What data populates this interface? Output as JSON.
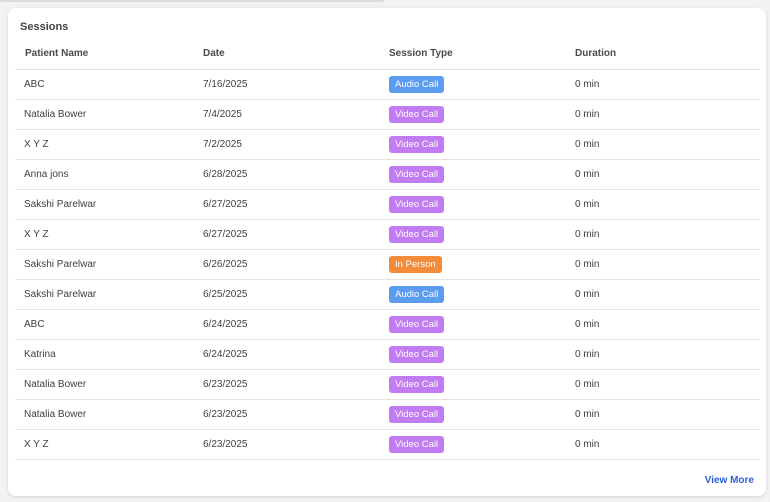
{
  "card": {
    "title": "Sessions",
    "view_more_label": "View More"
  },
  "table": {
    "headers": [
      "Patient Name",
      "Date",
      "Session Type",
      "Duration"
    ],
    "rows": [
      {
        "patient": "ABC",
        "date": "7/16/2025",
        "type": "Audio Call",
        "duration": "0 min"
      },
      {
        "patient": "Natalia Bower",
        "date": "7/4/2025",
        "type": "Video Call",
        "duration": "0 min"
      },
      {
        "patient": "X Y Z",
        "date": "7/2/2025",
        "type": "Video Call",
        "duration": "0 min"
      },
      {
        "patient": "Anna jons",
        "date": "6/28/2025",
        "type": "Video Call",
        "duration": "0 min"
      },
      {
        "patient": "Sakshi Parelwar",
        "date": "6/27/2025",
        "type": "Video Call",
        "duration": "0 min"
      },
      {
        "patient": "X Y Z",
        "date": "6/27/2025",
        "type": "Video Call",
        "duration": "0 min"
      },
      {
        "patient": "Sakshi Parelwar",
        "date": "6/26/2025",
        "type": "In Person",
        "duration": "0 min"
      },
      {
        "patient": "Sakshi Parelwar",
        "date": "6/25/2025",
        "type": "Audio Call",
        "duration": "0 min"
      },
      {
        "patient": "ABC",
        "date": "6/24/2025",
        "type": "Video Call",
        "duration": "0 min"
      },
      {
        "patient": "Katrina",
        "date": "6/24/2025",
        "type": "Video Call",
        "duration": "0 min"
      },
      {
        "patient": "Natalia Bower",
        "date": "6/23/2025",
        "type": "Video Call",
        "duration": "0 min"
      },
      {
        "patient": "Natalia Bower",
        "date": "6/23/2025",
        "type": "Video Call",
        "duration": "0 min"
      },
      {
        "patient": "X Y Z",
        "date": "6/23/2025",
        "type": "Video Call",
        "duration": "0 min"
      }
    ]
  },
  "colors": {
    "Audio Call": "#5b9cf0",
    "Video Call": "#c07cf0",
    "In Person": "#f28b3a",
    "link": "#2b5fd9"
  }
}
